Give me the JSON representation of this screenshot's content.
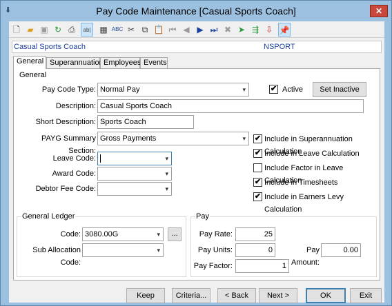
{
  "window": {
    "title": "Pay Code Maintenance  [Casual Sports Coach]",
    "close_glyph": "✕"
  },
  "toolbar": {
    "icons": [
      "new-document-icon",
      "open-folder-icon",
      "save-icon",
      "refresh-icon",
      "print-icon",
      "edit-field-icon",
      "calculator-icon",
      "spellcheck-icon",
      "cut-icon",
      "copy-icon",
      "paste-icon",
      "first-record-icon",
      "previous-record-icon",
      "next-record-icon",
      "last-record-icon",
      "delete-icon",
      "apply-icon",
      "export-icon",
      "import-icon",
      "pin-icon"
    ]
  },
  "header": {
    "name": "Casual Sports Coach",
    "code": "NSPORT"
  },
  "tabs": [
    {
      "label": "General",
      "active": true
    },
    {
      "label": "Superannuation",
      "active": false
    },
    {
      "label": "Employees",
      "active": false
    },
    {
      "label": "Events",
      "active": false
    }
  ],
  "general": {
    "group_title": "General",
    "pay_code_type_label": "Pay Code Type:",
    "pay_code_type_value": "Normal Pay",
    "active_label": "Active",
    "active_checked": true,
    "set_inactive_label": "Set Inactive",
    "description_label": "Description:",
    "description_value": "Casual Sports Coach",
    "short_description_label": "Short Description:",
    "short_description_value": "Sports Coach",
    "payg_label": "PAYG Summary Section:",
    "payg_value": "Gross Payments",
    "leave_code_label": "Leave Code:",
    "leave_code_value": "",
    "award_code_label": "Award Code:",
    "award_code_value": "",
    "debtor_fee_label": "Debtor Fee Code:",
    "debtor_fee_value": "",
    "options": [
      {
        "label": "Include in Superannuation Calculation",
        "checked": true
      },
      {
        "label": "Include in Leave Calculation",
        "checked": true
      },
      {
        "label": "Include Factor in Leave Calculation",
        "checked": false
      },
      {
        "label": "Include in Timesheets",
        "checked": true
      },
      {
        "label": "Include in Earners Levy Calculation",
        "checked": true
      }
    ]
  },
  "general_ledger": {
    "group_title": "General Ledger",
    "code_label": "Code:",
    "code_value": "3080.00G",
    "browse_label": "...",
    "sub_allocation_label": "Sub Allocation Code:",
    "sub_allocation_value": ""
  },
  "pay": {
    "group_title": "Pay",
    "pay_rate_label": "Pay Rate:",
    "pay_rate_value": "25",
    "pay_units_label": "Pay Units:",
    "pay_units_value": "0",
    "pay_amount_label": "Pay Amount:",
    "pay_amount_value": "0.00",
    "pay_factor_label": "Pay Factor:",
    "pay_factor_value": "1"
  },
  "buttons": {
    "keep": "Keep",
    "criteria": "Criteria...",
    "back": "< Back",
    "next": "Next >",
    "ok": "OK",
    "exit": "Exit"
  },
  "glyphs": {
    "check": "✔",
    "dropdown": "▾"
  }
}
